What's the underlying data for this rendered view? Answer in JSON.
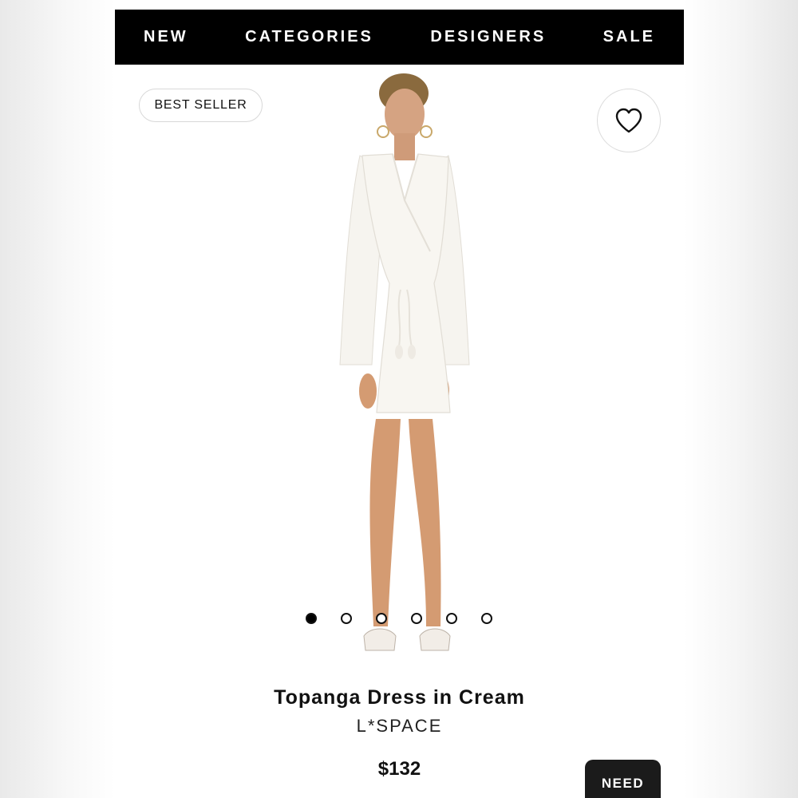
{
  "nav": {
    "items": [
      "NEW",
      "CATEGORIES",
      "DESIGNERS",
      "SALE"
    ]
  },
  "badge": {
    "label": "BEST SELLER"
  },
  "favorite": {
    "icon": "heart-icon"
  },
  "carousel": {
    "count": 6,
    "active_index": 0
  },
  "product": {
    "title": "Topanga Dress in Cream",
    "brand": "L*SPACE",
    "price": "$132"
  },
  "cta": {
    "label": "NEED"
  }
}
